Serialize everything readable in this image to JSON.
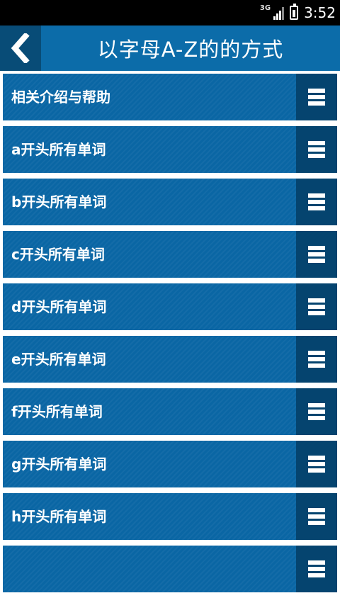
{
  "status_bar": {
    "network": "3G",
    "time": "3:52"
  },
  "header": {
    "title": "以字母A-Z的的方式"
  },
  "list": {
    "items": [
      {
        "label": "相关介绍与帮助"
      },
      {
        "label": "a开头所有单词"
      },
      {
        "label": "b开头所有单词"
      },
      {
        "label": "c开头所有单词"
      },
      {
        "label": "d开头所有单词"
      },
      {
        "label": "e开头所有单词"
      },
      {
        "label": "f开头所有单词"
      },
      {
        "label": "g开头所有单词"
      },
      {
        "label": "h开头所有单词"
      },
      {
        "label": ""
      }
    ]
  },
  "colors": {
    "header": "#0c6ca9",
    "row": "#0a66a4",
    "accent_dark": "#05446f"
  }
}
